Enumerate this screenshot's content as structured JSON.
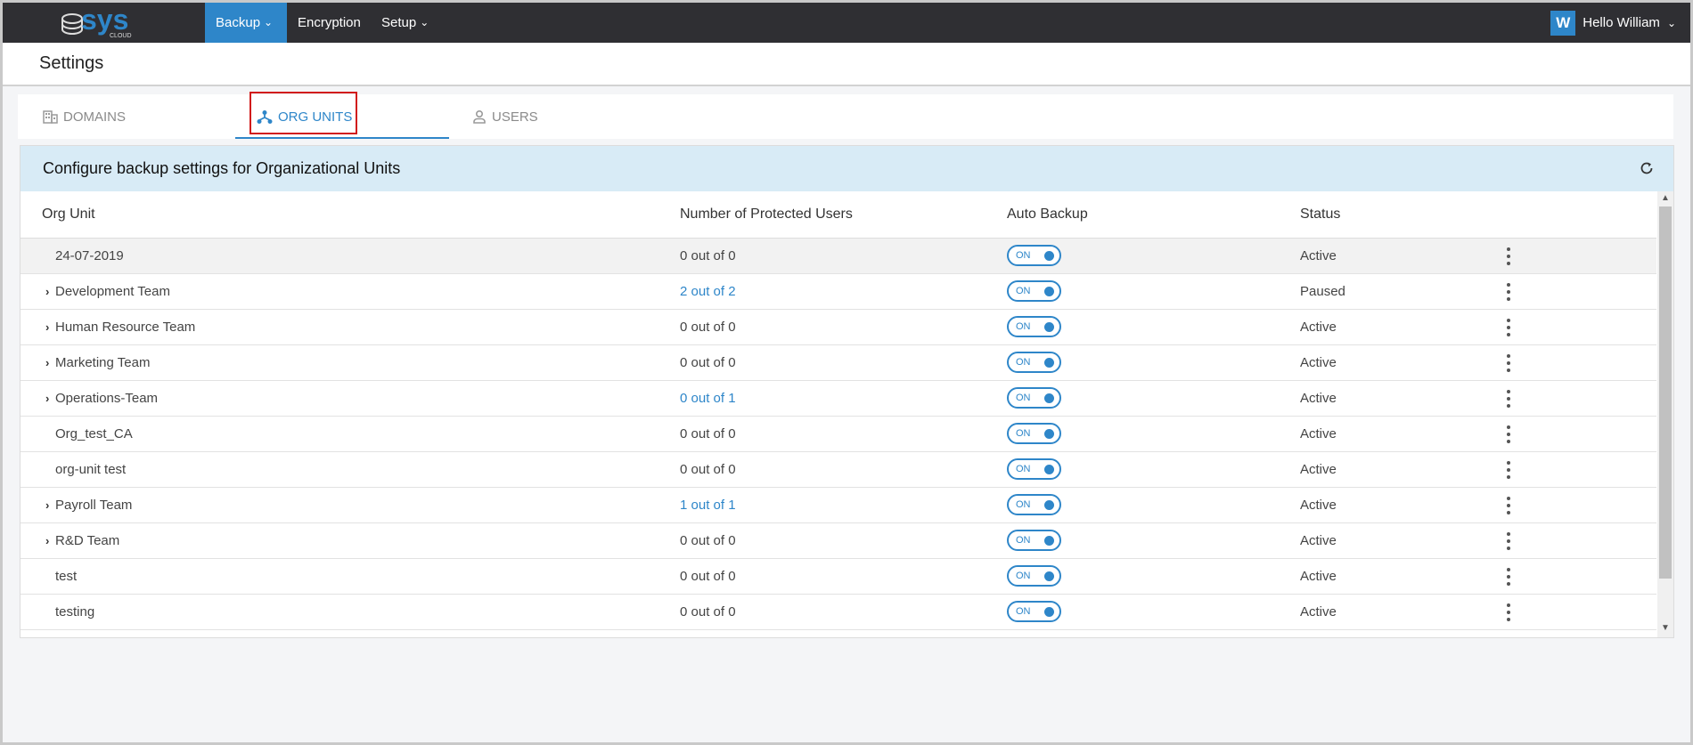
{
  "brand": {
    "logo_text": "sys",
    "logo_sub": "CLOUD"
  },
  "nav": {
    "items": [
      {
        "label": "Backup",
        "has_caret": true,
        "active": true
      },
      {
        "label": "Encryption",
        "has_caret": false,
        "active": false
      },
      {
        "label": "Setup",
        "has_caret": true,
        "active": false
      }
    ],
    "user_initial": "W",
    "user_greeting": "Hello William"
  },
  "page": {
    "title": "Settings"
  },
  "tabs": [
    {
      "label": "DOMAINS",
      "icon": "building-icon",
      "active": false
    },
    {
      "label": "ORG UNITS",
      "icon": "org-tree-icon",
      "active": true
    },
    {
      "label": "USERS",
      "icon": "user-icon",
      "active": false
    }
  ],
  "panel": {
    "title": "Configure backup settings for Organizational Units",
    "refresh_icon": "refresh-icon"
  },
  "table": {
    "columns": [
      "Org Unit",
      "Number of Protected Users",
      "Auto Backup",
      "Status"
    ],
    "toggle_label": "ON",
    "rows": [
      {
        "name": "24-07-2019",
        "expandable": false,
        "protected": "0 out of 0",
        "link": false,
        "auto_backup": "ON",
        "status": "Active"
      },
      {
        "name": "Development Team",
        "expandable": true,
        "protected": "2 out of 2",
        "link": true,
        "auto_backup": "ON",
        "status": "Paused"
      },
      {
        "name": "Human Resource Team",
        "expandable": true,
        "protected": "0 out of 0",
        "link": false,
        "auto_backup": "ON",
        "status": "Active"
      },
      {
        "name": "Marketing Team",
        "expandable": true,
        "protected": "0 out of 0",
        "link": false,
        "auto_backup": "ON",
        "status": "Active"
      },
      {
        "name": "Operations-Team",
        "expandable": true,
        "protected": "0 out of 1",
        "link": true,
        "auto_backup": "ON",
        "status": "Active"
      },
      {
        "name": "Org_test_CA",
        "expandable": false,
        "protected": "0 out of 0",
        "link": false,
        "auto_backup": "ON",
        "status": "Active"
      },
      {
        "name": "org-unit test",
        "expandable": false,
        "protected": "0 out of 0",
        "link": false,
        "auto_backup": "ON",
        "status": "Active"
      },
      {
        "name": "Payroll Team",
        "expandable": true,
        "protected": "1 out of 1",
        "link": true,
        "auto_backup": "ON",
        "status": "Active"
      },
      {
        "name": "R&D Team",
        "expandable": true,
        "protected": "0 out of 0",
        "link": false,
        "auto_backup": "ON",
        "status": "Active"
      },
      {
        "name": "test",
        "expandable": false,
        "protected": "0 out of 0",
        "link": false,
        "auto_backup": "ON",
        "status": "Active"
      },
      {
        "name": "testing",
        "expandable": false,
        "protected": "0 out of 0",
        "link": false,
        "auto_backup": "ON",
        "status": "Active"
      }
    ]
  },
  "colors": {
    "accent": "#2e86c9",
    "topbar": "#2f2f33",
    "panel_header": "#d8ebf6",
    "highlight": "#d11a1a"
  }
}
